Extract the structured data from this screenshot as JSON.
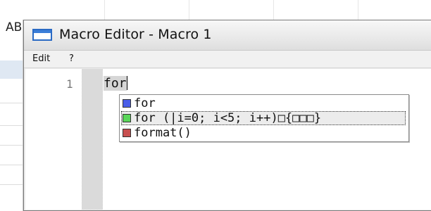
{
  "background": {
    "title_fragment": "АB"
  },
  "window": {
    "title": "Macro Editor - Macro 1"
  },
  "menu": {
    "items": [
      {
        "label": "Edit"
      },
      {
        "label": "?"
      }
    ]
  },
  "editor": {
    "line_number": "1",
    "code_text": "for"
  },
  "autocomplete": {
    "items": [
      {
        "label": "for",
        "swatch_color": "#4a5ee8",
        "selected": false
      },
      {
        "label": "for (|i=0; i<5; i++)□{□□□}",
        "swatch_color": "#5ad65a",
        "selected": true
      },
      {
        "label": "format()",
        "swatch_color": "#c85050",
        "selected": false
      }
    ]
  },
  "colors": {
    "title_icon": "#2a6ac4",
    "selection_bg": "#ececec"
  }
}
